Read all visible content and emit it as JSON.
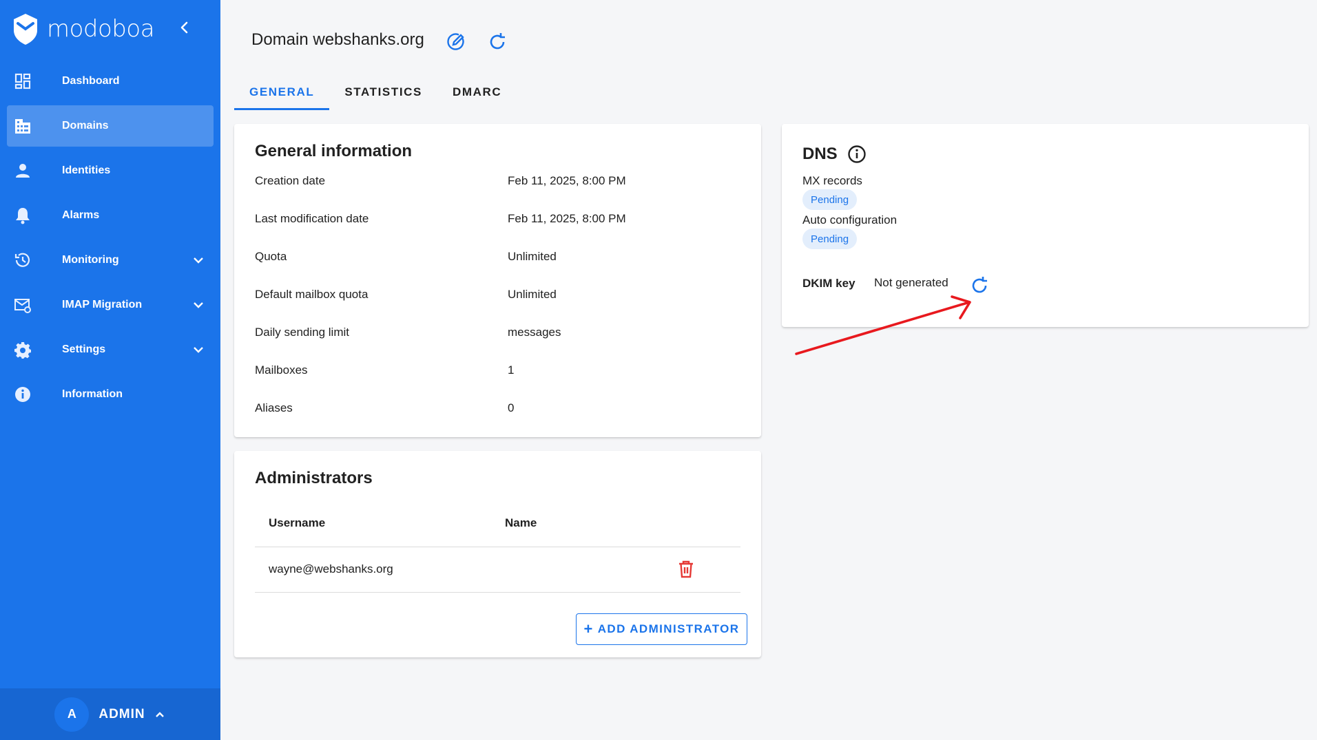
{
  "brand": {
    "name": "modoboa"
  },
  "sidebar": {
    "items": [
      {
        "label": "Dashboard",
        "icon": "dashboard-icon"
      },
      {
        "label": "Domains",
        "icon": "domains-icon",
        "active": true
      },
      {
        "label": "Identities",
        "icon": "person-icon"
      },
      {
        "label": "Alarms",
        "icon": "bell-icon"
      },
      {
        "label": "Monitoring",
        "icon": "history-icon",
        "expandable": true
      },
      {
        "label": "IMAP Migration",
        "icon": "mail-sync-icon",
        "expandable": true
      },
      {
        "label": "Settings",
        "icon": "gear-icon",
        "expandable": true
      },
      {
        "label": "Information",
        "icon": "info-icon"
      }
    ]
  },
  "user": {
    "initial": "A",
    "name": "ADMIN"
  },
  "header": {
    "title": "Domain webshanks.org"
  },
  "tabs": [
    {
      "label": "GENERAL",
      "active": true
    },
    {
      "label": "STATISTICS"
    },
    {
      "label": "DMARC"
    }
  ],
  "general": {
    "title": "General information",
    "rows": [
      {
        "label": "Creation date",
        "value": "Feb 11, 2025, 8:00 PM"
      },
      {
        "label": "Last modification date",
        "value": "Feb 11, 2025, 8:00 PM"
      },
      {
        "label": "Quota",
        "value": "Unlimited"
      },
      {
        "label": "Default mailbox quota",
        "value": "Unlimited"
      },
      {
        "label": "Daily sending limit",
        "value": "messages"
      },
      {
        "label": "Mailboxes",
        "value": "1"
      },
      {
        "label": "Aliases",
        "value": "0"
      }
    ]
  },
  "admins": {
    "title": "Administrators",
    "columns": [
      "Username",
      "Name"
    ],
    "rows": [
      {
        "username": "wayne@webshanks.org",
        "name": ""
      }
    ],
    "add_label": "ADD ADMINISTRATOR"
  },
  "dns": {
    "title": "DNS",
    "mx_label": "MX records",
    "mx_status": "Pending",
    "auto_label": "Auto configuration",
    "auto_status": "Pending",
    "dkim_label": "DKIM key",
    "dkim_value": "Not generated"
  },
  "colors": {
    "primary": "#1b74ea",
    "danger": "#e53935",
    "annotation": "#e8191e"
  }
}
